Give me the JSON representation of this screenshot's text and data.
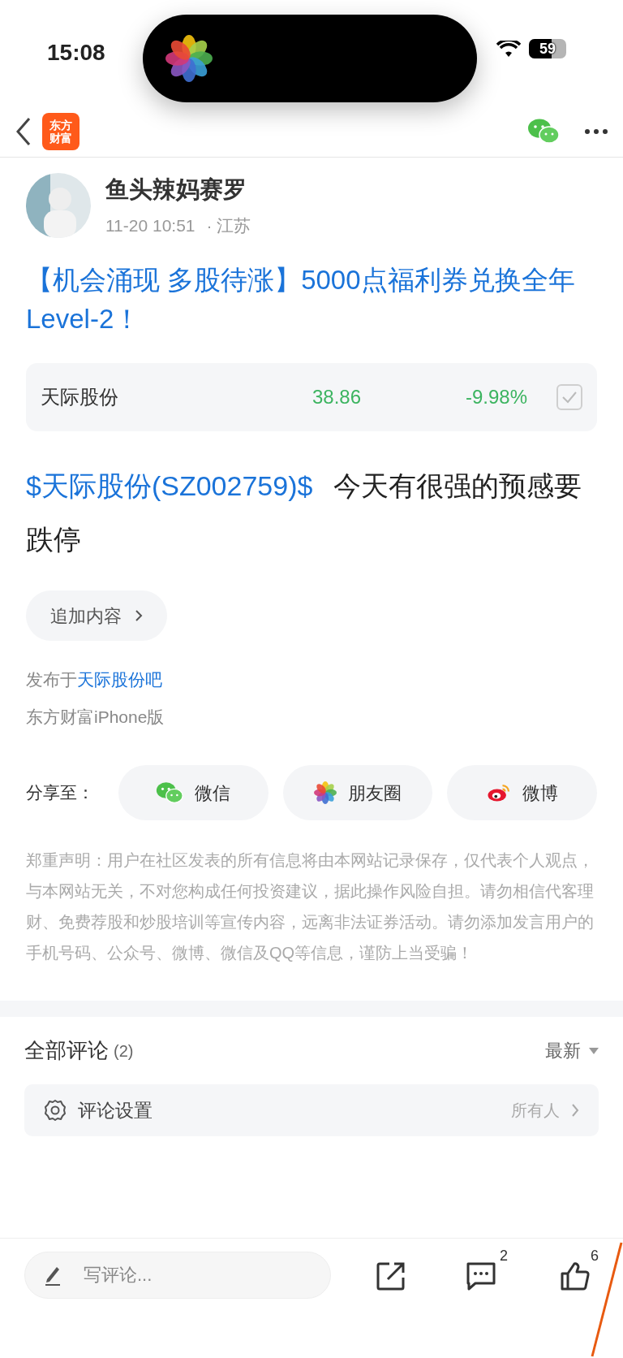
{
  "status_bar": {
    "time": "15:08",
    "battery": "59"
  },
  "nav": {
    "logo_lines": [
      "东方",
      "财富"
    ]
  },
  "post": {
    "author": "鱼头辣妈赛罗",
    "date": "11-20 10:51",
    "location": "· 江苏",
    "title": "【机会涌现 多股待涨】5000点福利券兑换全年Level-2！",
    "stock": {
      "name": "天际股份",
      "price": "38.86",
      "change": "-9.98%",
      "checked": true
    },
    "body_link": "$天际股份(SZ002759)$",
    "body_text": "今天有很强的预感要跌停",
    "append_button": "追加内容",
    "published_prefix": "发布于",
    "published_bar": "天际股份吧",
    "client": "东方财富iPhone版"
  },
  "share": {
    "label": "分享至：",
    "targets": [
      {
        "kind": "wechat",
        "label": "微信"
      },
      {
        "kind": "moments",
        "label": "朋友圈"
      },
      {
        "kind": "weibo",
        "label": "微博"
      }
    ]
  },
  "disclaimer": "郑重声明：用户在社区发表的所有信息将由本网站记录保存，仅代表个人观点，与本网站无关，不对您构成任何投资建议，据此操作风险自担。请勿相信代客理财、免费荐股和炒股培训等宣传内容，远离非法证券活动。请勿添加发言用户的手机号码、公众号、微博、微信及QQ等信息，谨防上当受骗！",
  "comments": {
    "title": "全部评论",
    "count": "(2)",
    "sort": "最新",
    "settings_label": "评论设置",
    "settings_value": "所有人"
  },
  "bottom_bar": {
    "placeholder": "写评论...",
    "comment_count": "2",
    "like_count": "6"
  }
}
